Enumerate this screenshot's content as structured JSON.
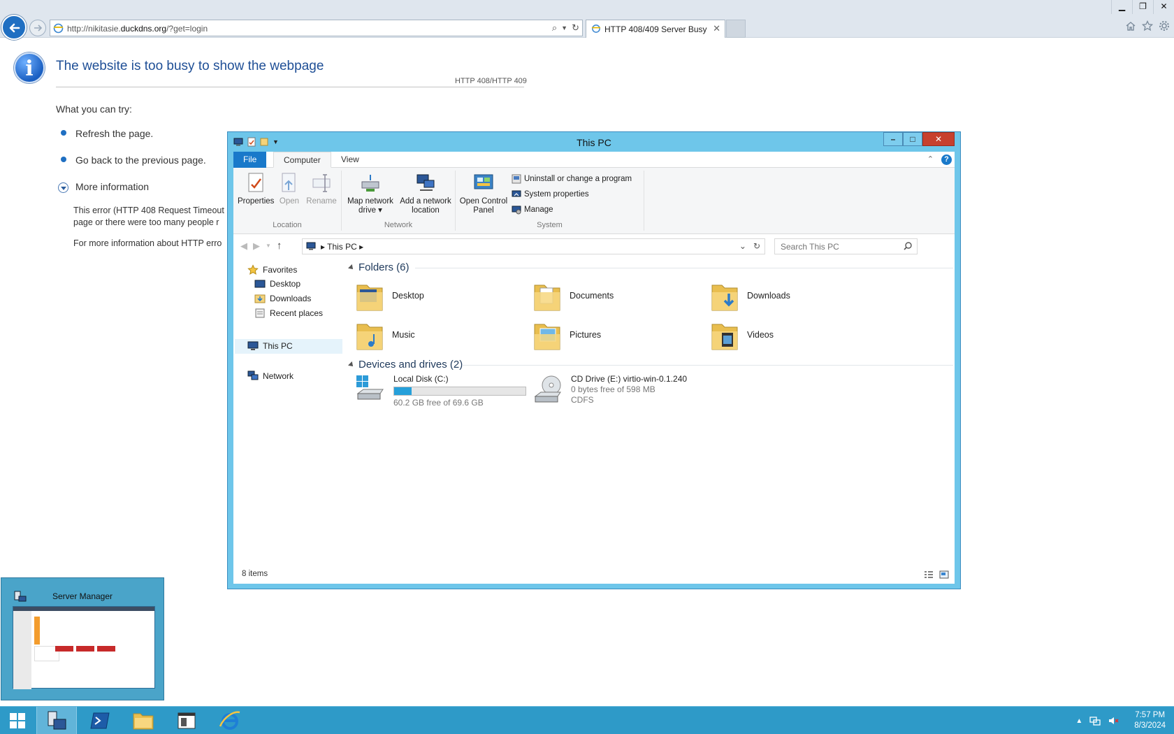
{
  "browser": {
    "url_prefix": "http://nikitasie.",
    "url_domain": "duckdns.org",
    "url_suffix": "/?get=login",
    "tab_title": "HTTP 408/409 Server Busy",
    "tab_close": "✕"
  },
  "error_page": {
    "title": "The website is too busy to show the webpage",
    "code": "HTTP 408/HTTP 409",
    "what_you_can_try": "What you can try:",
    "bullets": [
      "Refresh the page.",
      "Go back to the previous page."
    ],
    "more_info": "More information",
    "para1_line1": "This error (HTTP 408 Request Timeout",
    "para1_line2": "page or there were too many people r",
    "para2": "For more information about HTTP erro"
  },
  "explorer": {
    "title": "This PC",
    "tabs": {
      "file": "File",
      "computer": "Computer",
      "view": "View"
    },
    "ribbon": {
      "location_group": "Location",
      "network_group": "Network",
      "system_group": "System",
      "properties": "Properties",
      "open": "Open",
      "rename": "Rename",
      "map_drive_l1": "Map network",
      "map_drive_l2": "drive",
      "add_loc_l1": "Add a network",
      "add_loc_l2": "location",
      "ocp_l1": "Open Control",
      "ocp_l2": "Panel",
      "uninstall": "Uninstall or change a program",
      "sys_props": "System properties",
      "manage": "Manage"
    },
    "breadcrumb": "This PC",
    "search_placeholder": "Search This PC",
    "nav": {
      "favorites": "Favorites",
      "desktop": "Desktop",
      "downloads": "Downloads",
      "recent": "Recent places",
      "this_pc": "This PC",
      "network": "Network"
    },
    "folders_header": "Folders (6)",
    "folders": [
      "Desktop",
      "Documents",
      "Downloads",
      "Music",
      "Pictures",
      "Videos"
    ],
    "drives_header": "Devices and drives (2)",
    "drive_c": {
      "name": "Local Disk (C:)",
      "free": "60.2 GB free of 69.6 GB",
      "used_fraction": 0.135
    },
    "drive_e": {
      "name": "CD Drive (E:) virtio-win-0.1.240",
      "free": "0 bytes free of 598 MB",
      "fs": "CDFS"
    },
    "status_items": "8 items"
  },
  "preview": {
    "title": "Server Manager"
  },
  "clock": {
    "time": "7:57 PM",
    "date": "8/3/2024"
  },
  "colors": {
    "accent": "#1979ca",
    "window_frame": "#6ec6ea",
    "taskbar": "#2e9ac8",
    "close": "#c7402e"
  }
}
